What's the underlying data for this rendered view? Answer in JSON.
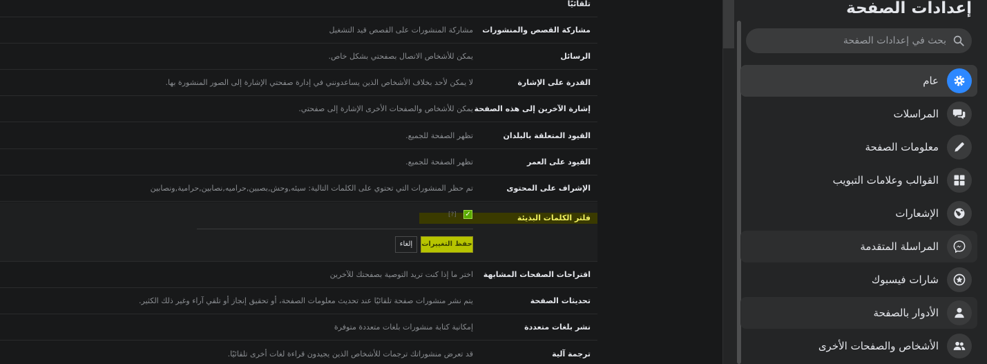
{
  "settings": {
    "top_fragment_label": "تلقائيًا",
    "rows": [
      {
        "label": "مشاركة القصص والمنشورات",
        "value": "مشاركة المنشورات على القصص قيد التشغيل"
      },
      {
        "label": "الرسائل",
        "value": "يمكن للأشخاص الاتصال بصفحتي بشكل خاص."
      },
      {
        "label": "القدرة على الإشارة",
        "value": "لا يمكن لأحد بخلاف الأشخاص الذين يساعدونني في إدارة صفحتي الإشارة إلى الصور المنشورة بها."
      },
      {
        "label": "إشارة الآخرين إلى هذه الصفحة",
        "value": "يمكن للأشخاص والصفحات الأخرى الإشارة إلى صفحتي."
      },
      {
        "label": "القيود المتعلقة بالبلدان",
        "value": "تظهر الصفحة للجميع."
      },
      {
        "label": "القيود على العمر",
        "value": "تظهر الصفحة للجميع."
      },
      {
        "label": "الإشراف على المحتوى",
        "value": "تم حظر المنشورات التي تحتوي على الكلمات التالية: سيئه,وحش,بصبين,حراميه,نصابين,حرامية,ونصابين"
      }
    ],
    "filter": {
      "label": "فلتر الكلمات البذيئة",
      "checkmark": "✓",
      "help": "[?]",
      "save_label": "حفظ التغييرات",
      "cancel_label": "إلغاء"
    },
    "rows_after": [
      {
        "label": "اقتراحات الصفحات المشابهة",
        "value": "اختر ما إذا كنت تريد التوصية بصفحتك للآخرين"
      },
      {
        "label": "تحديثات الصفحة",
        "value": "يتم نشر منشورات صفحة تلقائيًا عند تحديث معلومات الصفحة، أو تحقيق إنجاز أو تلقي آراء وغير ذلك الكثير."
      },
      {
        "label": "نشر بلغات متعددة",
        "value": "إمكانية كتابة منشورات بلغات متعددة متوفرة"
      },
      {
        "label": "ترجمة آلية",
        "value": "قد تعرض منشوراتك ترجمات للأشخاص الذين يجيدون قراءة لغات أخرى تلقائيًا."
      }
    ]
  },
  "sidebar": {
    "title": "إعدادات الصفحة",
    "search_placeholder": "بحث في إعدادات الصفحة",
    "items": [
      {
        "label": "عام",
        "icon": "gear-icon"
      },
      {
        "label": "المراسلات",
        "icon": "chat-bubbles-icon"
      },
      {
        "label": "معلومات الصفحة",
        "icon": "pencil-icon"
      },
      {
        "label": "القوالب وعلامات التبويب",
        "icon": "grid-icon"
      },
      {
        "label": "الإشعارات",
        "icon": "globe-icon"
      },
      {
        "label": "المراسلة المتقدمة",
        "icon": "messenger-icon"
      },
      {
        "label": "شارات فيسبوك",
        "icon": "star-badge-icon"
      },
      {
        "label": "الأدوار بالصفحة",
        "icon": "person-icon"
      },
      {
        "label": "الأشخاص والصفحات الأخرى",
        "icon": "people-icon"
      }
    ]
  },
  "colors": {
    "accent": "#2d88ff",
    "save_button": "#b7c400",
    "filter_highlight_text": "#f0f060",
    "checkbox": "#5aa900"
  }
}
